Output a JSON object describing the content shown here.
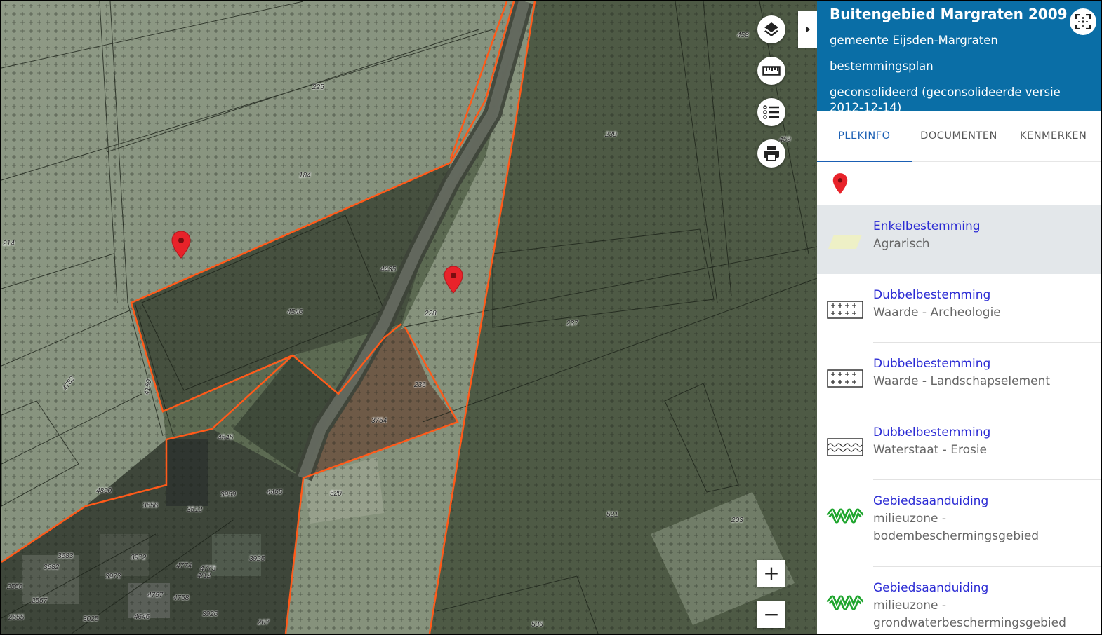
{
  "panel": {
    "title": "Buitengebied Margraten 2009",
    "municipality": "gemeente Eijsden-Margraten",
    "plan_type": "bestemmingsplan",
    "status": "geconsolideerd (geconsolideerde versie 2012-12-14)",
    "tabs": [
      {
        "label": "PLEKINFO",
        "active": true
      },
      {
        "label": "DOCUMENTEN",
        "active": false
      },
      {
        "label": "KENMERKEN",
        "active": false
      }
    ],
    "items": [
      {
        "category": "Enkelbestemming",
        "value": "Agrarisch",
        "symbol": "yellow-parallelogram",
        "selected": true
      },
      {
        "category": "Dubbelbestemming",
        "value": "Waarde - Archeologie",
        "symbol": "plus-grid"
      },
      {
        "category": "Dubbelbestemming",
        "value": "Waarde - Landschapselement",
        "symbol": "plus-grid"
      },
      {
        "category": "Dubbelbestemming",
        "value": "Waterstaat - Erosie",
        "symbol": "wave-hatch"
      },
      {
        "category": "Gebiedsaanduiding",
        "value": "milieuzone - bodembeschermingsgebied",
        "symbol": "green-zigzag"
      },
      {
        "category": "Gebiedsaanduiding",
        "value": "milieuzone - grondwaterbeschermingsgebied",
        "symbol": "green-zigzag"
      }
    ]
  },
  "map": {
    "tools": [
      "layers-icon",
      "measure-ruler-icon",
      "legend-list-icon",
      "print-icon"
    ],
    "zoom_in": "+",
    "zoom_out": "−",
    "parcels": [
      "225",
      "184",
      "214",
      "4435",
      "4546",
      "228",
      "239",
      "237",
      "236",
      "3754",
      "4782",
      "4150",
      "4545",
      "3959",
      "4465",
      "520",
      "4800",
      "3556",
      "3512",
      "3683",
      "3972",
      "3682",
      "3973",
      "4774",
      "4773",
      "4/12",
      "3925",
      "2556",
      "2557",
      "4757",
      "4758",
      "2555",
      "3025",
      "4646",
      "3926",
      "207",
      "536",
      "521",
      "203",
      "458",
      "459"
    ],
    "colors": {
      "plan_outline": "#ff5a1a",
      "marker": "#e8232a",
      "header": "#0a6ea6",
      "link": "#2b2bd4"
    }
  }
}
